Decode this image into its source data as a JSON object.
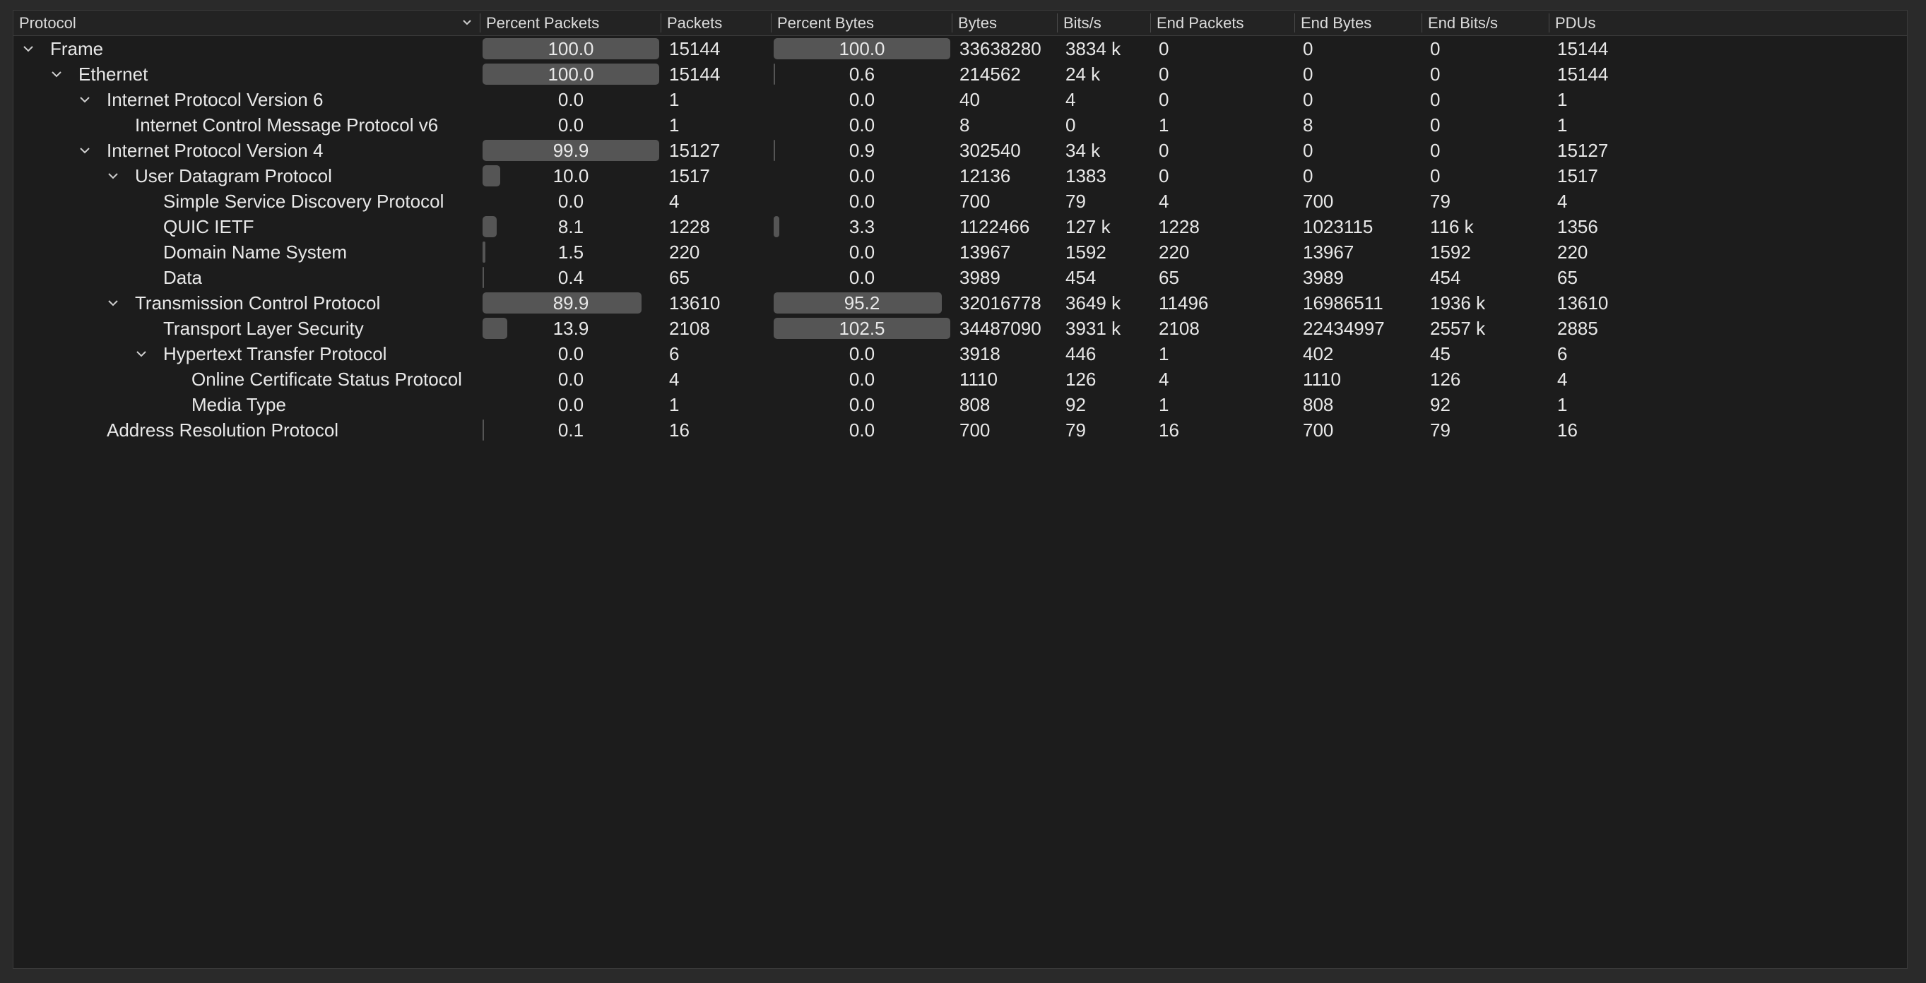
{
  "header": {
    "protocol": "Protocol",
    "percent_packets": "Percent Packets",
    "packets": "Packets",
    "percent_bytes": "Percent Bytes",
    "bytes": "Bytes",
    "bits_s": "Bits/s",
    "end_packets": "End Packets",
    "end_bytes": "End Bytes",
    "end_bits_s": "End Bits/s",
    "pdus": "PDUs"
  },
  "rows": [
    {
      "name": "Frame",
      "level": 0,
      "expanded": true,
      "pct_packets": "100.0",
      "packets": "15144",
      "pct_bytes": "100.0",
      "bytes": "33638280",
      "bits_s": "3834 k",
      "end_packets": "0",
      "end_bytes": "0",
      "end_bits_s": "0",
      "pdus": "15144"
    },
    {
      "name": "Ethernet",
      "level": 1,
      "expanded": true,
      "pct_packets": "100.0",
      "packets": "15144",
      "pct_bytes": "0.6",
      "bytes": "214562",
      "bits_s": "24 k",
      "end_packets": "0",
      "end_bytes": "0",
      "end_bits_s": "0",
      "pdus": "15144"
    },
    {
      "name": "Internet Protocol Version 6",
      "level": 2,
      "expanded": true,
      "pct_packets": "0.0",
      "packets": "1",
      "pct_bytes": "0.0",
      "bytes": "40",
      "bits_s": "4",
      "end_packets": "0",
      "end_bytes": "0",
      "end_bits_s": "0",
      "pdus": "1"
    },
    {
      "name": "Internet Control Message Protocol v6",
      "level": 3,
      "expanded": null,
      "pct_packets": "0.0",
      "packets": "1",
      "pct_bytes": "0.0",
      "bytes": "8",
      "bits_s": "0",
      "end_packets": "1",
      "end_bytes": "8",
      "end_bits_s": "0",
      "pdus": "1"
    },
    {
      "name": "Internet Protocol Version 4",
      "level": 2,
      "expanded": true,
      "pct_packets": "99.9",
      "packets": "15127",
      "pct_bytes": "0.9",
      "bytes": "302540",
      "bits_s": "34 k",
      "end_packets": "0",
      "end_bytes": "0",
      "end_bits_s": "0",
      "pdus": "15127"
    },
    {
      "name": "User Datagram Protocol",
      "level": 3,
      "expanded": true,
      "pct_packets": "10.0",
      "packets": "1517",
      "pct_bytes": "0.0",
      "bytes": "12136",
      "bits_s": "1383",
      "end_packets": "0",
      "end_bytes": "0",
      "end_bits_s": "0",
      "pdus": "1517"
    },
    {
      "name": "Simple Service Discovery Protocol",
      "level": 4,
      "expanded": null,
      "pct_packets": "0.0",
      "packets": "4",
      "pct_bytes": "0.0",
      "bytes": "700",
      "bits_s": "79",
      "end_packets": "4",
      "end_bytes": "700",
      "end_bits_s": "79",
      "pdus": "4"
    },
    {
      "name": "QUIC IETF",
      "level": 4,
      "expanded": null,
      "pct_packets": "8.1",
      "packets": "1228",
      "pct_bytes": "3.3",
      "bytes": "1122466",
      "bits_s": "127 k",
      "end_packets": "1228",
      "end_bytes": "1023115",
      "end_bits_s": "116 k",
      "pdus": "1356"
    },
    {
      "name": "Domain Name System",
      "level": 4,
      "expanded": null,
      "pct_packets": "1.5",
      "packets": "220",
      "pct_bytes": "0.0",
      "bytes": "13967",
      "bits_s": "1592",
      "end_packets": "220",
      "end_bytes": "13967",
      "end_bits_s": "1592",
      "pdus": "220"
    },
    {
      "name": "Data",
      "level": 4,
      "expanded": null,
      "pct_packets": "0.4",
      "packets": "65",
      "pct_bytes": "0.0",
      "bytes": "3989",
      "bits_s": "454",
      "end_packets": "65",
      "end_bytes": "3989",
      "end_bits_s": "454",
      "pdus": "65"
    },
    {
      "name": "Transmission Control Protocol",
      "level": 3,
      "expanded": true,
      "pct_packets": "89.9",
      "packets": "13610",
      "pct_bytes": "95.2",
      "bytes": "32016778",
      "bits_s": "3649 k",
      "end_packets": "11496",
      "end_bytes": "16986511",
      "end_bits_s": "1936 k",
      "pdus": "13610"
    },
    {
      "name": "Transport Layer Security",
      "level": 4,
      "expanded": null,
      "pct_packets": "13.9",
      "packets": "2108",
      "pct_bytes": "102.5",
      "bytes": "34487090",
      "bits_s": "3931 k",
      "end_packets": "2108",
      "end_bytes": "22434997",
      "end_bits_s": "2557 k",
      "pdus": "2885"
    },
    {
      "name": "Hypertext Transfer Protocol",
      "level": 4,
      "expanded": true,
      "pct_packets": "0.0",
      "packets": "6",
      "pct_bytes": "0.0",
      "bytes": "3918",
      "bits_s": "446",
      "end_packets": "1",
      "end_bytes": "402",
      "end_bits_s": "45",
      "pdus": "6"
    },
    {
      "name": "Online Certificate Status Protocol",
      "level": 5,
      "expanded": null,
      "pct_packets": "0.0",
      "packets": "4",
      "pct_bytes": "0.0",
      "bytes": "1110",
      "bits_s": "126",
      "end_packets": "4",
      "end_bytes": "1110",
      "end_bits_s": "126",
      "pdus": "4"
    },
    {
      "name": "Media Type",
      "level": 5,
      "expanded": null,
      "pct_packets": "0.0",
      "packets": "1",
      "pct_bytes": "0.0",
      "bytes": "808",
      "bits_s": "92",
      "end_packets": "1",
      "end_bytes": "808",
      "end_bits_s": "92",
      "pdus": "1"
    },
    {
      "name": "Address Resolution Protocol",
      "level": 2,
      "expanded": null,
      "pct_packets": "0.1",
      "packets": "16",
      "pct_bytes": "0.0",
      "bytes": "700",
      "bits_s": "79",
      "end_packets": "16",
      "end_bytes": "700",
      "end_bits_s": "79",
      "pdus": "16"
    }
  ],
  "icons": {
    "expand": "chevron-down-icon",
    "sort": "chevron-down-icon"
  },
  "colors": {
    "bar_fill": "#555555",
    "background": "#1c1c1c",
    "header_bg": "#232323"
  }
}
